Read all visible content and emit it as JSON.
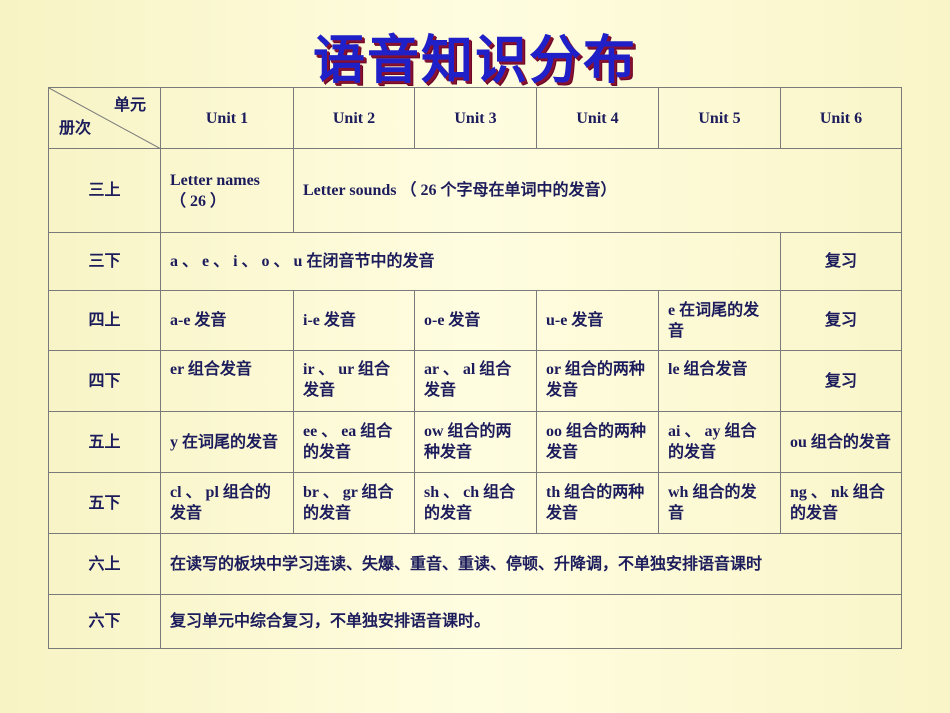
{
  "title": "语音知识分布",
  "header": {
    "corner_top": "单元",
    "corner_bottom": "册次",
    "units": [
      "Unit 1",
      "Unit 2",
      "Unit 3",
      "Unit 4",
      "Unit 5",
      "Unit 6"
    ]
  },
  "rows": {
    "r1": {
      "label": "三上",
      "c1_line1": "Letter names",
      "c1_line2": "（ 26 ）",
      "c2": "Letter sounds （ 26 个字母在单词中的发音）"
    },
    "r2": {
      "label": "三下",
      "c1": "a 、 e 、 i 、 o 、 u 在闭音节中的发音",
      "c6": "复习"
    },
    "r3": {
      "label": "四上",
      "cells": [
        "a-e 发音",
        "i-e 发音",
        "o-e 发音",
        "u-e 发音",
        "e 在词尾的发音",
        "复习"
      ]
    },
    "r4": {
      "label": "四下",
      "cells": [
        "er 组合发音",
        "ir 、 ur 组合发音",
        "ar 、 al 组合发音",
        "or 组合的两种发音",
        "le 组合发音",
        "复习"
      ]
    },
    "r5": {
      "label": "五上",
      "cells": [
        "y 在词尾的发音",
        "ee 、 ea 组合的发音",
        "ow 组合的两种发音",
        "oo 组合的两种发音",
        "ai 、 ay 组合的发音",
        "ou 组合的发音"
      ]
    },
    "r6": {
      "label": "五下",
      "cells": [
        "cl 、 pl 组合的发音",
        "br 、 gr 组合的发音",
        "sh 、 ch 组合的发音",
        "th 组合的两种发音",
        "wh 组合的发音",
        "ng 、 nk 组合的发音"
      ]
    },
    "r7": {
      "label": "六上",
      "c1": "在读写的板块中学习连读、失爆、重音、重读、停顿、升降调，不单独安排语音课时"
    },
    "r8": {
      "label": "六下",
      "c1": "复习单元中综合复习，不单独安排语音课时。"
    }
  }
}
